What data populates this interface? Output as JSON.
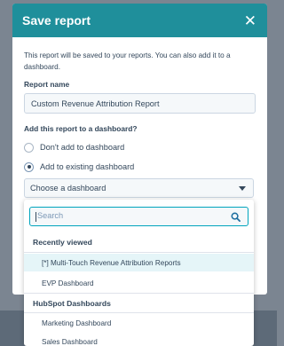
{
  "modal": {
    "title": "Save report",
    "description": "This report will be saved to your reports. You can also add it to a dashboard.",
    "report_name_label": "Report name",
    "report_name_value": "Custom Revenue Attribution Report",
    "add_to_dashboard_label": "Add this report to a dashboard?",
    "radio_options": [
      {
        "label": "Don't add to dashboard",
        "checked": false
      },
      {
        "label": "Add to existing dashboard",
        "checked": true
      }
    ],
    "dashboard_select_value": "Choose a dashboard"
  },
  "dropdown": {
    "search_placeholder": "Search",
    "sections": [
      {
        "header": "Recently viewed",
        "items": [
          "[*] Multi-Touch Revenue Attribution Reports",
          "EVP Dashboard"
        ]
      },
      {
        "header": "HubSpot Dashboards",
        "items": [
          "Marketing Dashboard",
          "Sales Dashboard"
        ]
      }
    ]
  },
  "colors": {
    "header_bg": "#1f8f9b",
    "focus_border": "#00a4bd",
    "highlight_row": "#e5f5f8",
    "text": "#33475b"
  },
  "icons": {
    "close": "close-icon",
    "search": "search-icon",
    "caret": "chevron-down-icon"
  }
}
